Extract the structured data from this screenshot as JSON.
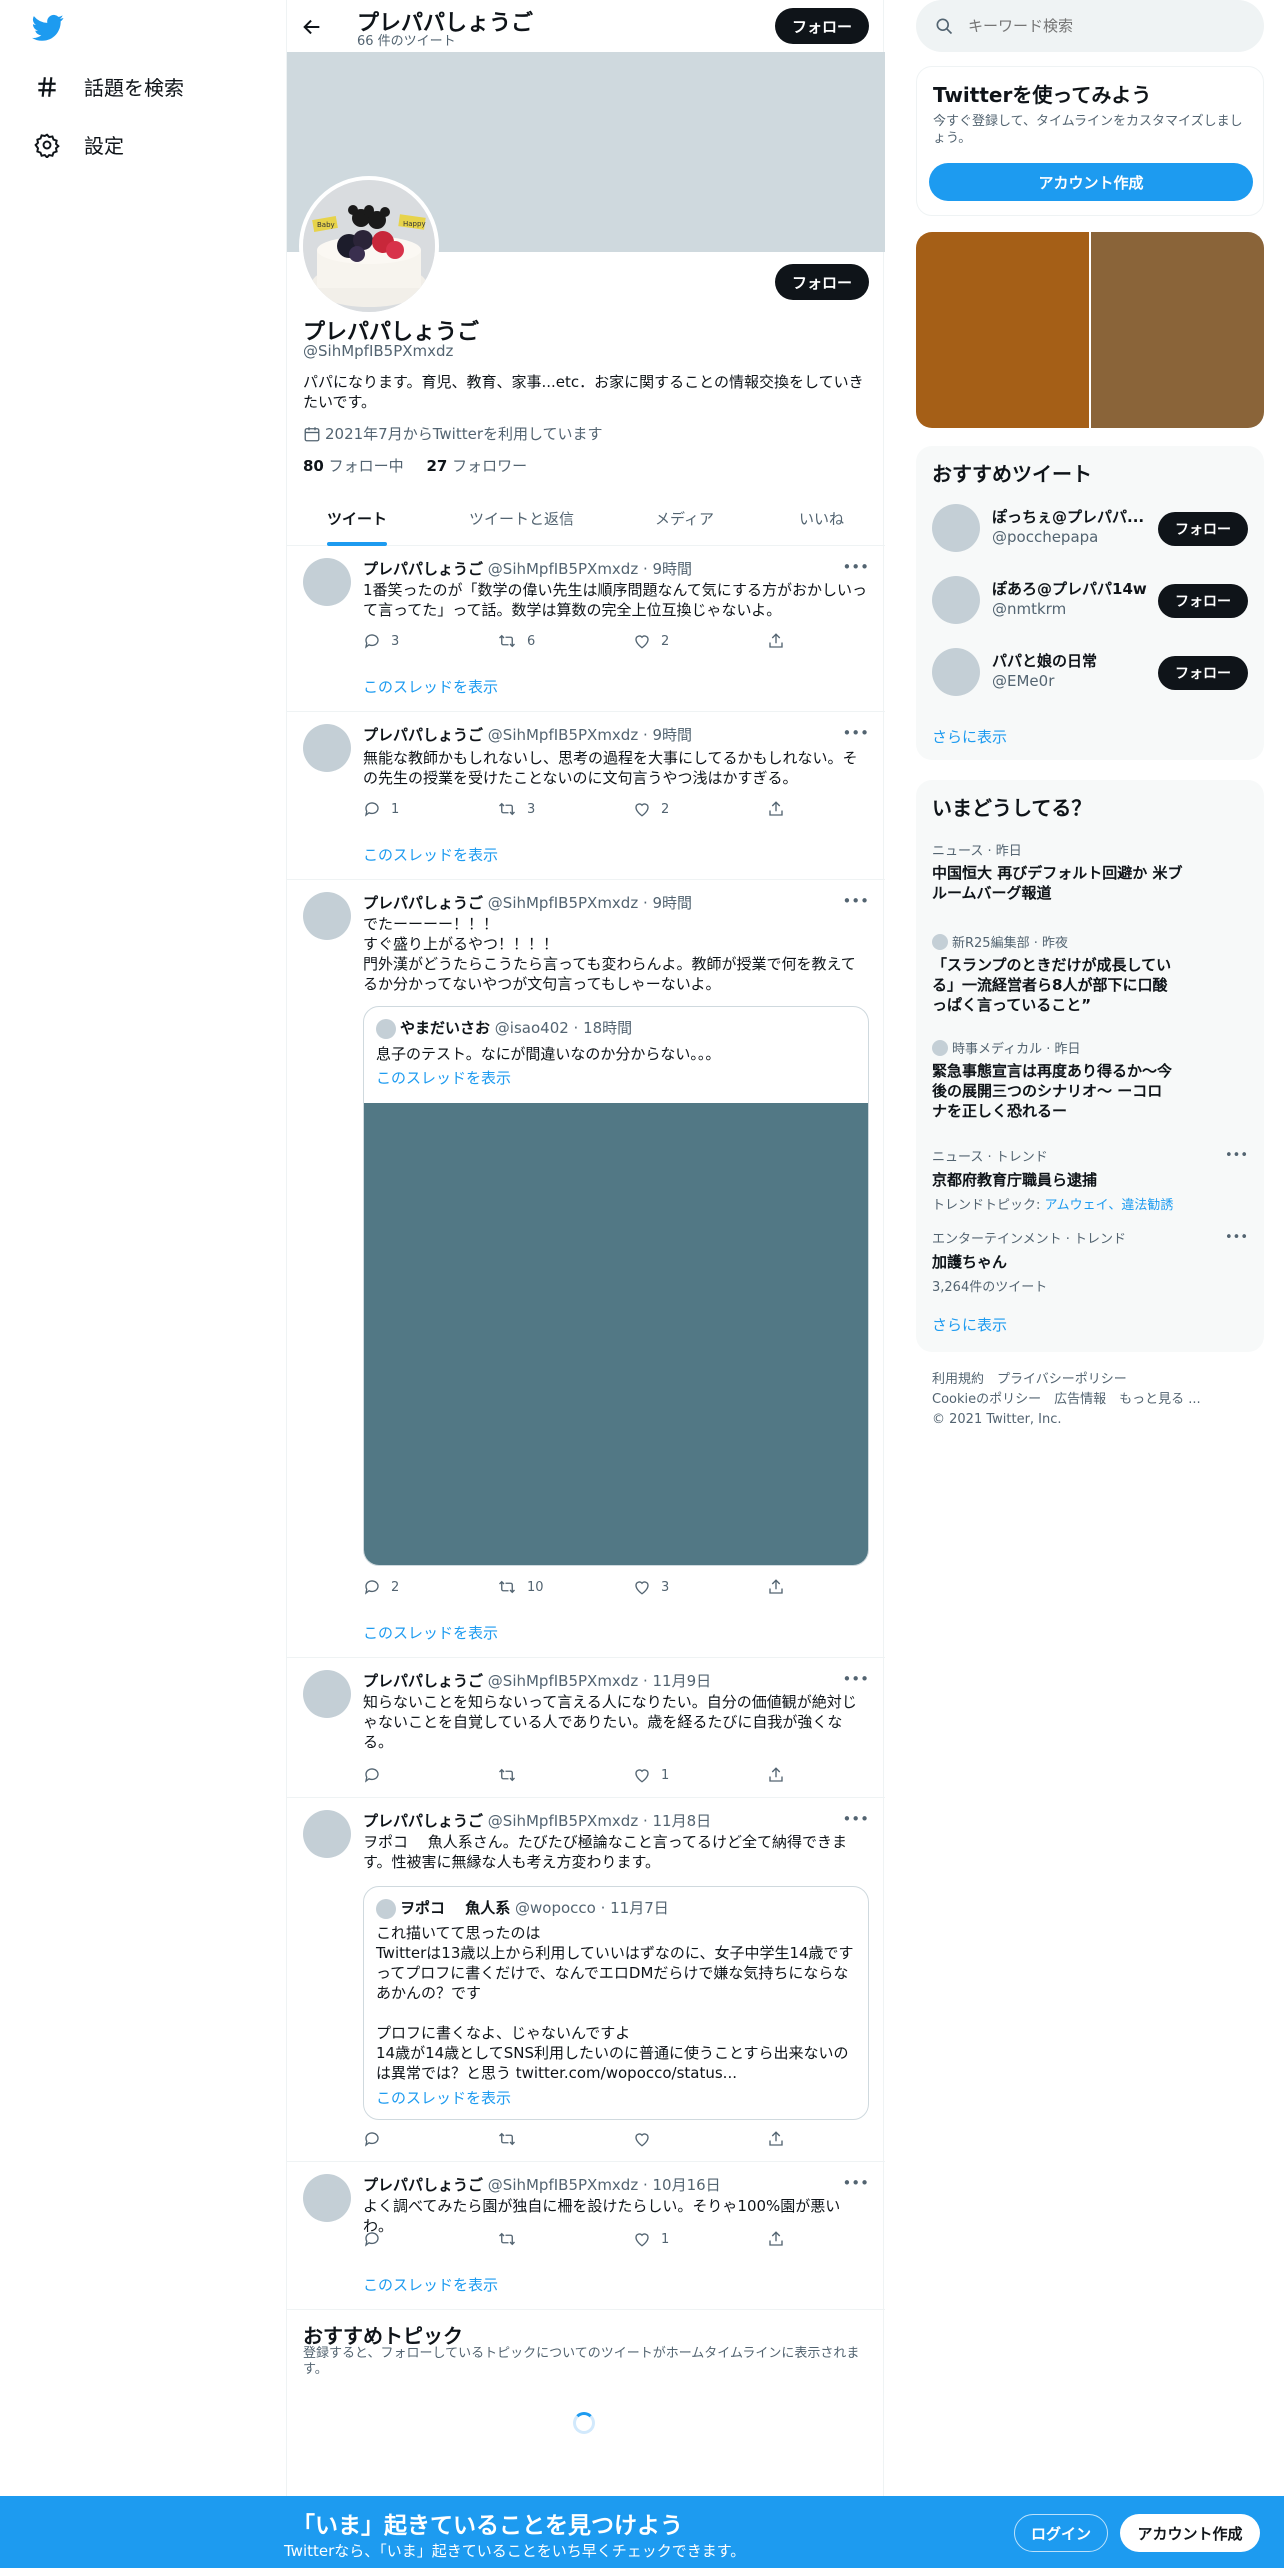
{
  "nav": {
    "explore_label": "話題を検索",
    "settings_label": "設定"
  },
  "header": {
    "title": "プレパパしょうご",
    "tweet_count": "66 件のツイート",
    "follow_label": "フォロー"
  },
  "profile": {
    "name": "プレパパしょうご",
    "handle": "@SihMpfIB5PXmxdz",
    "bio": "パパになります。育児、教育、家事...etc．お家に関することの情報交換をしていきたいです。",
    "joined": "2021年7月からTwitterを利用しています",
    "following_count": "80",
    "following_label": "フォロー中",
    "followers_count": "27",
    "followers_label": "フォロワー",
    "follow_label": "フォロー",
    "cake_flags": [
      "Baby",
      "Happy"
    ]
  },
  "tabs": [
    "ツイート",
    "ツイートと返信",
    "メディア",
    "いいね"
  ],
  "tweets": [
    {
      "name": "プレパパしょうご",
      "meta": "@SihMpfIB5PXmxdz · 9時間",
      "text": "1番笑ったのが「数学の偉い先生は順序問題なんて気にする方がおかしいって言ってた」って話。数学は算数の完全上位互換じゃないよ。",
      "replies": "3",
      "retweets": "6",
      "likes": "2",
      "thread": "このスレッドを表示"
    },
    {
      "name": "プレパパしょうご",
      "meta": "@SihMpfIB5PXmxdz · 9時間",
      "text": "無能な教師かもしれないし、思考の過程を大事にしてるかもしれない。その先生の授業を受けたことないのに文句言うやつ浅はかすぎる。",
      "replies": "1",
      "retweets": "3",
      "likes": "2",
      "thread": "このスレッドを表示"
    },
    {
      "name": "プレパパしょうご",
      "meta": "@SihMpfIB5PXmxdz · 9時間",
      "text": "でたーーーー！！！\nすぐ盛り上がるやつ！！！！\n門外漢がどうたらこうたら言っても変わらんよ。教師が授業で何を教えてるか分かってないやつが文句言ってもしゃーないよ。",
      "replies": "2",
      "retweets": "10",
      "likes": "3",
      "thread": "このスレッドを表示",
      "quote": {
        "name": "やまだいさお",
        "meta": "@isao402 · 18時間",
        "text": "息子のテスト。なにが間違いなのか分からない。。。",
        "thread": "このスレッドを表示"
      }
    },
    {
      "name": "プレパパしょうご",
      "meta": "@SihMpfIB5PXmxdz · 11月9日",
      "text": "知らないことを知らないって言える人になりたい。自分の価値観が絶対じゃないことを自覚している人でありたい。歳を経るたびに自我が強くなる。",
      "replies": "",
      "retweets": "",
      "likes": "1"
    },
    {
      "name": "プレパパしょうご",
      "meta": "@SihMpfIB5PXmxdz · 11月8日",
      "text": "ヲポコ　 魚人系さん。たびたび極論なこと言ってるけど全て納得できます。性被害に無縁な人も考え方変わります。",
      "replies": "",
      "retweets": "",
      "likes": "",
      "quote": {
        "name": "ヲポコ　 魚人系",
        "meta": "@wopocco · 11月7日",
        "text": "これ描いてて思ったのは\nTwitterは13歳以上から利用していいはずなのに、女子中学生14歳ですってプロフに書くだけで、なんでエロDMだらけで嫌な気持ちにならなあかんの？です\n\nプロフに書くなよ、じゃないんですよ\n14歳が14歳としてSNS利用したいのに普通に使うことすら出来ないのは異常では？と思う twitter.com/wopocco/status...",
        "thread": "このスレッドを表示"
      }
    },
    {
      "name": "プレパパしょうご",
      "meta": "@SihMpfIB5PXmxdz · 10月16日",
      "text": "よく調べてみたら園が独自に柵を設けたらしい。そりゃ100%園が悪いわ。",
      "replies": "",
      "retweets": "",
      "likes": "1",
      "thread": "このスレッドを表示"
    }
  ],
  "topics": {
    "title": "おすすめトピック",
    "desc": "登録すると、フォローしているトピックについてのツイートがホームタイムラインに表示されます。"
  },
  "right": {
    "search_placeholder": "キーワード検索",
    "signup": {
      "title": "Twitterを使ってみよう",
      "desc": "今すぐ登録して、タイムラインをカスタマイズしましょう。",
      "button": "アカウント作成"
    },
    "suggest": {
      "title": "おすすめツイート",
      "users": [
        {
          "name": "ぽっちぇ@プレパパ...",
          "handle": "@pocchepapa",
          "button": "フォロー"
        },
        {
          "name": "ぽあろ@プレパパ14w",
          "handle": "@nmtkrm",
          "button": "フォロー"
        },
        {
          "name": "パパと娘の日常",
          "handle": "@EMe0r",
          "button": "フォロー"
        }
      ],
      "more": "さらに表示"
    },
    "trends": {
      "title": "いまどうしてる？",
      "items": [
        {
          "meta": "ニュース · 昨日",
          "title": "中国恒大 再びデフォルト回避か 米ブルームバーグ報道",
          "sub": ""
        },
        {
          "meta": "新R25編集部 · 昨夜",
          "title": "「スランプのときだけが成長している」一流経営者ら8人が部下に口酸っぱく言っていること”",
          "sub": ""
        },
        {
          "meta": "時事メディカル · 昨日",
          "title": "緊急事態宣言は再度あり得るか～今後の展開三つのシナリオ～ ーコロナを正しく恐れるー",
          "sub": ""
        },
        {
          "meta": "ニュース · トレンド",
          "title": "京都府教育庁職員ら逮捕",
          "sub_prefix": "トレンドトピック: ",
          "sub": "アムウェイ、違法勧誘"
        },
        {
          "meta": "エンターテインメント · トレンド",
          "title": "加護ちゃん",
          "sub": "3,264件のツイート"
        }
      ],
      "more": "さらに表示"
    },
    "footer": {
      "line1": "利用規約　プライバシーポリシー",
      "line2": "Cookieのポリシー　広告情報　もっと見る ...",
      "line3": "© 2021 Twitter, Inc."
    }
  },
  "bottom": {
    "title": "「いま」起きていることを見つけよう",
    "sub": "Twitterなら、「いま」起きていることをいち早くチェックできます。",
    "login": "ログイン",
    "signup": "アカウント作成"
  },
  "colors": {
    "brand": "#1d9bf0",
    "dark": "#0f1419",
    "muted": "#536471",
    "quote_media": "#527885"
  }
}
